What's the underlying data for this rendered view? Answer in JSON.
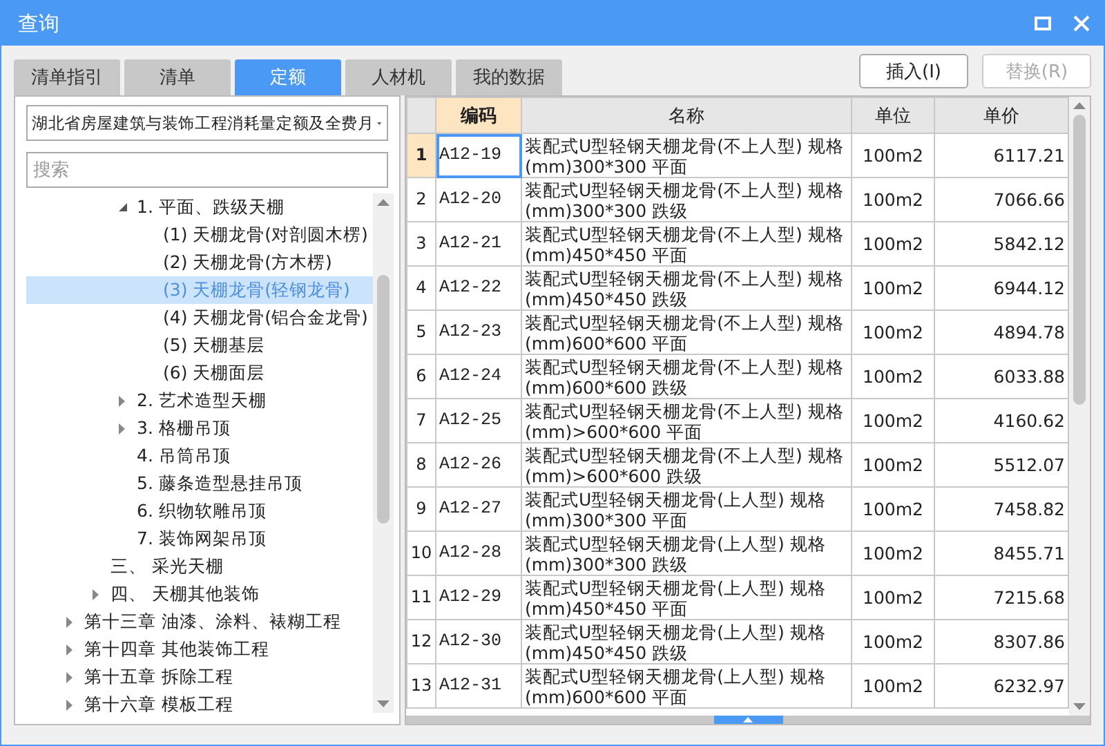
{
  "window": {
    "title": "查询"
  },
  "tabs": [
    {
      "label": "清单指引",
      "selected": false
    },
    {
      "label": "清单",
      "selected": false
    },
    {
      "label": "定额",
      "selected": true
    },
    {
      "label": "人材机",
      "selected": false
    },
    {
      "label": "我的数据",
      "selected": false
    }
  ],
  "buttons": [
    {
      "label": "插入(I)",
      "disabled": false
    },
    {
      "label": "替换(R)",
      "disabled": true
    }
  ],
  "library_select": {
    "value": "湖北省房屋建筑与装饰工程消耗量定额及全费月"
  },
  "search": {
    "placeholder": "搜索"
  },
  "tree": [
    {
      "children": [
        {
          "children": [
            {
              "label": "1. 平面、跌级天棚",
              "selected": false,
              "expanded": true,
              "children": [
                {
                  "label": "(1) 天棚龙骨(对剖圆木楞)",
                  "selected": false
                },
                {
                  "label": "(2) 天棚龙骨(方木楞)",
                  "selected": false
                },
                {
                  "label": "(3) 天棚龙骨(轻钢龙骨)",
                  "selected": true
                },
                {
                  "label": "(4) 天棚龙骨(铝合金龙骨)",
                  "selected": false
                },
                {
                  "label": "(5) 天棚基层",
                  "selected": false
                },
                {
                  "label": "(6) 天棚面层",
                  "selected": false
                }
              ]
            },
            {
              "label": "2. 艺术造型天棚",
              "selected": false,
              "expanded": false
            },
            {
              "label": "3. 格栅吊顶",
              "selected": false,
              "expanded": false
            },
            {
              "label": "4. 吊筒吊顶",
              "selected": false
            },
            {
              "label": "5. 藤条造型悬挂吊顶",
              "selected": false
            },
            {
              "label": "6. 织物软雕吊顶",
              "selected": false
            },
            {
              "label": "7. 装饰网架吊顶",
              "selected": false
            }
          ]
        },
        {
          "label": "三、 采光天棚",
          "selected": false
        },
        {
          "label": "四、 天棚其他装饰",
          "selected": false,
          "expanded": false
        }
      ]
    },
    {
      "label": "第十三章 油漆、涂料、裱糊工程",
      "selected": false,
      "expanded": false
    },
    {
      "label": "第十四章 其他装饰工程",
      "selected": false,
      "expanded": false
    },
    {
      "label": "第十五章 拆除工程",
      "selected": false,
      "expanded": false
    },
    {
      "label": "第十六章 模板工程",
      "selected": false,
      "expanded": false
    }
  ],
  "table": {
    "columns": [
      {
        "label": "编码",
        "selected": true
      },
      {
        "label": "名称",
        "selected": false
      },
      {
        "label": "单位",
        "selected": false
      },
      {
        "label": "单价",
        "selected": false
      }
    ],
    "rows": [
      {
        "index": "1",
        "code": "A12-19",
        "name": "装配式U型轻钢天棚龙骨(不上人型) 规格(mm)300*300 平面",
        "unit": "100m2",
        "price": "6117.21",
        "selected": true
      },
      {
        "index": "2",
        "code": "A12-20",
        "name": "装配式U型轻钢天棚龙骨(不上人型) 规格(mm)300*300 跌级",
        "unit": "100m2",
        "price": "7066.66",
        "selected": false
      },
      {
        "index": "3",
        "code": "A12-21",
        "name": "装配式U型轻钢天棚龙骨(不上人型) 规格(mm)450*450 平面",
        "unit": "100m2",
        "price": "5842.12",
        "selected": false
      },
      {
        "index": "4",
        "code": "A12-22",
        "name": "装配式U型轻钢天棚龙骨(不上人型) 规格(mm)450*450 跌级",
        "unit": "100m2",
        "price": "6944.12",
        "selected": false
      },
      {
        "index": "5",
        "code": "A12-23",
        "name": "装配式U型轻钢天棚龙骨(不上人型) 规格(mm)600*600 平面",
        "unit": "100m2",
        "price": "4894.78",
        "selected": false
      },
      {
        "index": "6",
        "code": "A12-24",
        "name": "装配式U型轻钢天棚龙骨(不上人型) 规格(mm)600*600 跌级",
        "unit": "100m2",
        "price": "6033.88",
        "selected": false
      },
      {
        "index": "7",
        "code": "A12-25",
        "name": "装配式U型轻钢天棚龙骨(不上人型) 规格(mm)>600*600 平面",
        "unit": "100m2",
        "price": "4160.62",
        "selected": false
      },
      {
        "index": "8",
        "code": "A12-26",
        "name": "装配式U型轻钢天棚龙骨(不上人型) 规格(mm)>600*600 跌级",
        "unit": "100m2",
        "price": "5512.07",
        "selected": false
      },
      {
        "index": "9",
        "code": "A12-27",
        "name": "装配式U型轻钢天棚龙骨(上人型) 规格(mm)300*300 平面",
        "unit": "100m2",
        "price": "7458.82",
        "selected": false
      },
      {
        "index": "10",
        "code": "A12-28",
        "name": "装配式U型轻钢天棚龙骨(上人型) 规格(mm)300*300 跌级",
        "unit": "100m2",
        "price": "8455.71",
        "selected": false
      },
      {
        "index": "11",
        "code": "A12-29",
        "name": "装配式U型轻钢天棚龙骨(上人型) 规格(mm)450*450 平面",
        "unit": "100m2",
        "price": "7215.68",
        "selected": false
      },
      {
        "index": "12",
        "code": "A12-30",
        "name": "装配式U型轻钢天棚龙骨(上人型) 规格(mm)450*450 跌级",
        "unit": "100m2",
        "price": "8307.86",
        "selected": false
      },
      {
        "index": "13",
        "code": "A12-31",
        "name": "装配式U型轻钢天棚龙骨(上人型) 规格(mm)600*600 平面",
        "unit": "100m2",
        "price": "6232.97",
        "selected": false
      }
    ]
  }
}
